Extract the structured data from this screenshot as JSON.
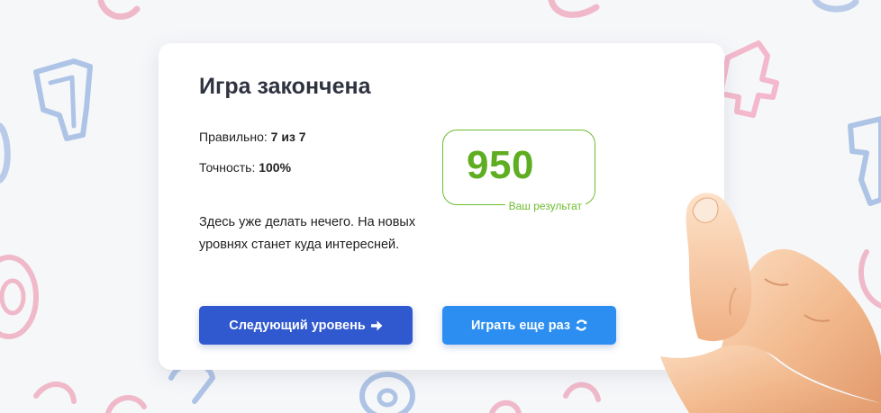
{
  "result": {
    "title": "Игра закончена",
    "correct_label": "Правильно: ",
    "correct_value": "7 из 7",
    "accuracy_label": "Точность: ",
    "accuracy_value": "100%",
    "message": "Здесь уже делать нечего. На новых уровнях станет куда интересней.",
    "score": "950",
    "score_label": "Ваш результат"
  },
  "buttons": {
    "next_label": "Следующий уровень",
    "next_icon": "arrow-right-icon",
    "replay_label": "Играть еще раз",
    "replay_icon": "refresh-icon"
  },
  "colors": {
    "score_green": "#5fae21",
    "next_button": "#3058cf",
    "replay_button": "#2b8ef0"
  }
}
